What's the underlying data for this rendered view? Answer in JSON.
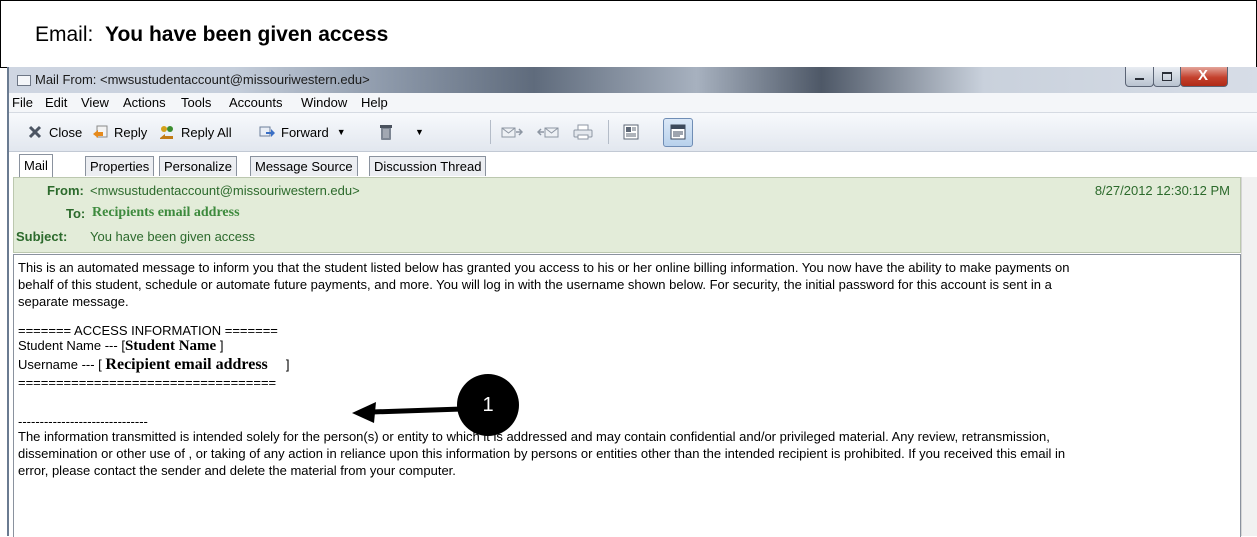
{
  "caption": {
    "prefix": "Email:",
    "title": "You have been given access"
  },
  "window": {
    "title": "Mail From: <mwsustudentaccount@missouriwestern.edu>",
    "controls": {
      "minimize": "",
      "maximize": "",
      "close": "X"
    }
  },
  "menu": [
    "File",
    "Edit",
    "View",
    "Actions",
    "Tools",
    "Accounts",
    "Window",
    "Help"
  ],
  "toolbar": {
    "close": "Close",
    "reply": "Reply",
    "reply_all": "Reply All",
    "forward": "Forward"
  },
  "tabs": [
    "Mail",
    "Properties",
    "Personalize",
    "Message Source",
    "Discussion Thread"
  ],
  "header": {
    "from_label": "From:",
    "from_value": "<mwsustudentaccount@missouriwestern.edu>",
    "date": "8/27/2012 12:30:12 PM",
    "to_label": "To:",
    "to_value": "Recipients email address",
    "subject_label": "Subject:",
    "subject_value": "You have been given access"
  },
  "body": {
    "intro1": "This is an automated message to inform you that the student listed below has granted you access to his or her online billing information.  You now have the ability to make payments on",
    "intro2": "behalf of this student, schedule or automate future payments, and more.  You will log in with the username shown below.  For security, the initial password for this account is sent in a",
    "intro3": "separate message.",
    "access_header": "======= ACCESS INFORMATION =======",
    "student_prefix": "Student Name --- [",
    "student_value": "Student Name",
    "student_suffix": "]",
    "username_prefix": "Username --- [",
    "username_value": "Recipient email address",
    "username_suffix": "]",
    "separator": "==================================",
    "dashes": "------------------------------",
    "legal1": "The information transmitted is intended solely for the person(s) or entity to which it is addressed and may contain confidential and/or privileged material.  Any review, retransmission,",
    "legal2": "dissemination or other use of , or taking of any action in reliance upon this information by persons or entities other than the intended recipient is prohibited. If you received this email  in",
    "legal3": "error, please contact the sender and delete the material from your computer."
  },
  "callout": {
    "number": "1"
  }
}
